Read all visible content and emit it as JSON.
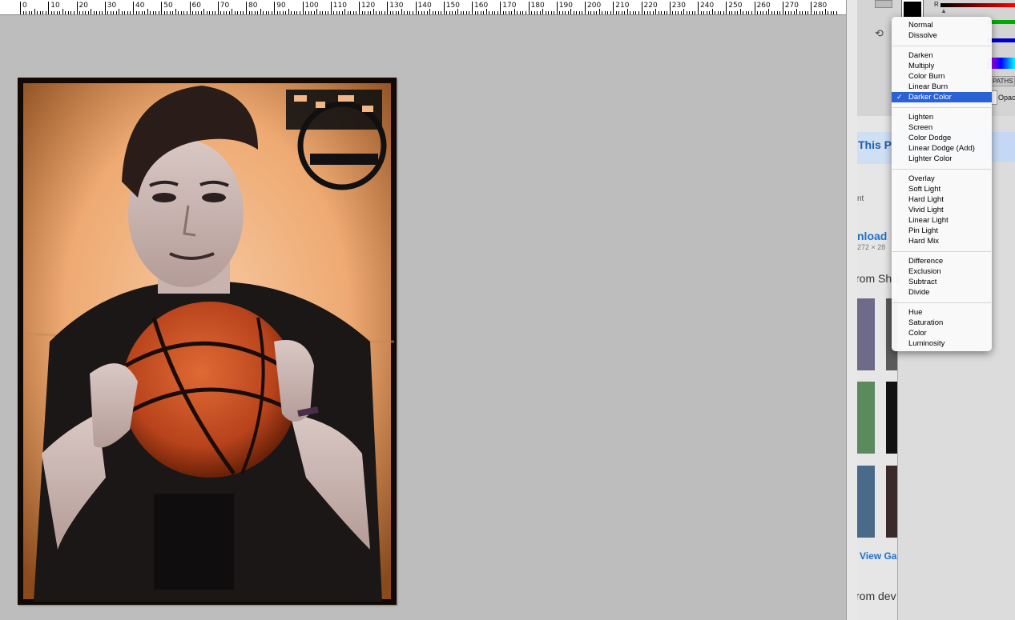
{
  "ruler": {
    "labels": [
      "0",
      "10",
      "20",
      "30",
      "40",
      "50",
      "60",
      "70",
      "80",
      "90",
      "100",
      "110",
      "120",
      "130",
      "140",
      "150",
      "160",
      "170",
      "180",
      "190",
      "200",
      "210",
      "220",
      "230",
      "240",
      "250",
      "260",
      "270",
      "280"
    ]
  },
  "panel": {
    "channel_label": "R",
    "paths_tab": "PATHS",
    "opacity_label": "Opac",
    "colors": {
      "foreground": "#000000",
      "background": "#ffffff"
    }
  },
  "web": {
    "heading1": "This P",
    "text1": "nt",
    "download": "nload",
    "dims": "272 × 28",
    "from1": "rom Shu",
    "view": "View Ga",
    "from2": "rom dev"
  },
  "blend_menu": {
    "selected": "Darker Color",
    "groups": [
      [
        "Normal",
        "Dissolve"
      ],
      [
        "Darken",
        "Multiply",
        "Color Burn",
        "Linear Burn",
        "Darker Color"
      ],
      [
        "Lighten",
        "Screen",
        "Color Dodge",
        "Linear Dodge (Add)",
        "Lighter Color"
      ],
      [
        "Overlay",
        "Soft Light",
        "Hard Light",
        "Vivid Light",
        "Linear Light",
        "Pin Light",
        "Hard Mix"
      ],
      [
        "Difference",
        "Exclusion",
        "Subtract",
        "Divide"
      ],
      [
        "Hue",
        "Saturation",
        "Color",
        "Luminosity"
      ]
    ]
  }
}
